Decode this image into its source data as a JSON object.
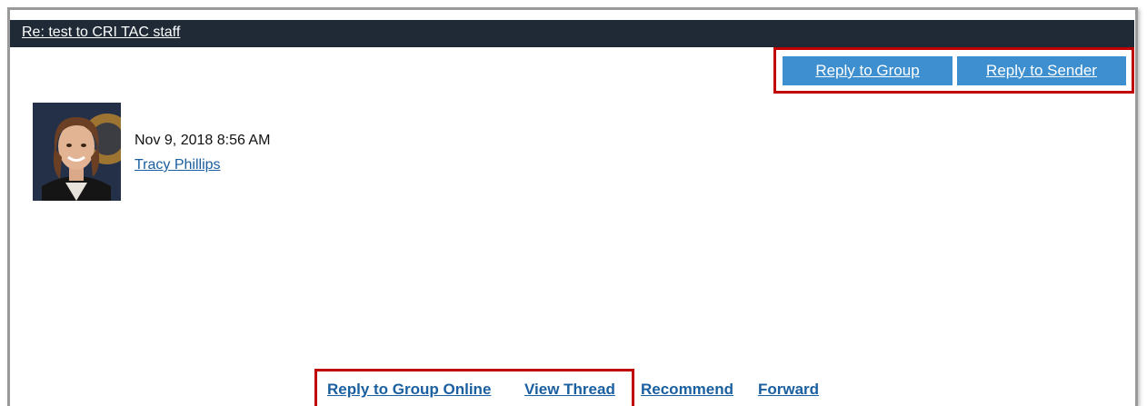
{
  "message": {
    "subject": "Re: test to CRI TAC staff",
    "date": "Nov 9, 2018 8:56 AM",
    "author": "Tracy Phillips"
  },
  "top_actions": {
    "reply_to_group": "Reply to Group",
    "reply_to_sender": "Reply to Sender"
  },
  "bottom_links": {
    "reply_to_group_online": "Reply to Group Online",
    "view_thread": "View Thread",
    "recommend": "Recommend",
    "forward": "Forward"
  },
  "colors": {
    "title_bar": "#1f2a36",
    "button": "#3d8fcf",
    "link": "#1a5fa0",
    "highlight": "#c00000"
  },
  "icons": {
    "avatar": "user-photo"
  }
}
